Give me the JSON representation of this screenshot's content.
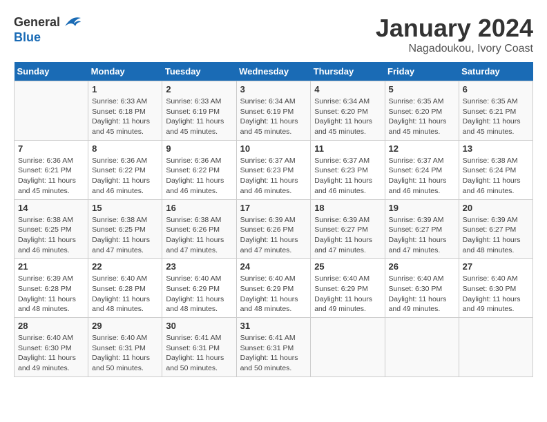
{
  "header": {
    "logo_general": "General",
    "logo_blue": "Blue",
    "month_title": "January 2024",
    "location": "Nagadoukou, Ivory Coast"
  },
  "days_of_week": [
    "Sunday",
    "Monday",
    "Tuesday",
    "Wednesday",
    "Thursday",
    "Friday",
    "Saturday"
  ],
  "weeks": [
    [
      {
        "day": "",
        "info": ""
      },
      {
        "day": "1",
        "info": "Sunrise: 6:33 AM\nSunset: 6:18 PM\nDaylight: 11 hours\nand 45 minutes."
      },
      {
        "day": "2",
        "info": "Sunrise: 6:33 AM\nSunset: 6:19 PM\nDaylight: 11 hours\nand 45 minutes."
      },
      {
        "day": "3",
        "info": "Sunrise: 6:34 AM\nSunset: 6:19 PM\nDaylight: 11 hours\nand 45 minutes."
      },
      {
        "day": "4",
        "info": "Sunrise: 6:34 AM\nSunset: 6:20 PM\nDaylight: 11 hours\nand 45 minutes."
      },
      {
        "day": "5",
        "info": "Sunrise: 6:35 AM\nSunset: 6:20 PM\nDaylight: 11 hours\nand 45 minutes."
      },
      {
        "day": "6",
        "info": "Sunrise: 6:35 AM\nSunset: 6:21 PM\nDaylight: 11 hours\nand 45 minutes."
      }
    ],
    [
      {
        "day": "7",
        "info": "Sunrise: 6:36 AM\nSunset: 6:21 PM\nDaylight: 11 hours\nand 45 minutes."
      },
      {
        "day": "8",
        "info": "Sunrise: 6:36 AM\nSunset: 6:22 PM\nDaylight: 11 hours\nand 46 minutes."
      },
      {
        "day": "9",
        "info": "Sunrise: 6:36 AM\nSunset: 6:22 PM\nDaylight: 11 hours\nand 46 minutes."
      },
      {
        "day": "10",
        "info": "Sunrise: 6:37 AM\nSunset: 6:23 PM\nDaylight: 11 hours\nand 46 minutes."
      },
      {
        "day": "11",
        "info": "Sunrise: 6:37 AM\nSunset: 6:23 PM\nDaylight: 11 hours\nand 46 minutes."
      },
      {
        "day": "12",
        "info": "Sunrise: 6:37 AM\nSunset: 6:24 PM\nDaylight: 11 hours\nand 46 minutes."
      },
      {
        "day": "13",
        "info": "Sunrise: 6:38 AM\nSunset: 6:24 PM\nDaylight: 11 hours\nand 46 minutes."
      }
    ],
    [
      {
        "day": "14",
        "info": "Sunrise: 6:38 AM\nSunset: 6:25 PM\nDaylight: 11 hours\nand 46 minutes."
      },
      {
        "day": "15",
        "info": "Sunrise: 6:38 AM\nSunset: 6:25 PM\nDaylight: 11 hours\nand 47 minutes."
      },
      {
        "day": "16",
        "info": "Sunrise: 6:38 AM\nSunset: 6:26 PM\nDaylight: 11 hours\nand 47 minutes."
      },
      {
        "day": "17",
        "info": "Sunrise: 6:39 AM\nSunset: 6:26 PM\nDaylight: 11 hours\nand 47 minutes."
      },
      {
        "day": "18",
        "info": "Sunrise: 6:39 AM\nSunset: 6:27 PM\nDaylight: 11 hours\nand 47 minutes."
      },
      {
        "day": "19",
        "info": "Sunrise: 6:39 AM\nSunset: 6:27 PM\nDaylight: 11 hours\nand 47 minutes."
      },
      {
        "day": "20",
        "info": "Sunrise: 6:39 AM\nSunset: 6:27 PM\nDaylight: 11 hours\nand 48 minutes."
      }
    ],
    [
      {
        "day": "21",
        "info": "Sunrise: 6:39 AM\nSunset: 6:28 PM\nDaylight: 11 hours\nand 48 minutes."
      },
      {
        "day": "22",
        "info": "Sunrise: 6:40 AM\nSunset: 6:28 PM\nDaylight: 11 hours\nand 48 minutes."
      },
      {
        "day": "23",
        "info": "Sunrise: 6:40 AM\nSunset: 6:29 PM\nDaylight: 11 hours\nand 48 minutes."
      },
      {
        "day": "24",
        "info": "Sunrise: 6:40 AM\nSunset: 6:29 PM\nDaylight: 11 hours\nand 48 minutes."
      },
      {
        "day": "25",
        "info": "Sunrise: 6:40 AM\nSunset: 6:29 PM\nDaylight: 11 hours\nand 49 minutes."
      },
      {
        "day": "26",
        "info": "Sunrise: 6:40 AM\nSunset: 6:30 PM\nDaylight: 11 hours\nand 49 minutes."
      },
      {
        "day": "27",
        "info": "Sunrise: 6:40 AM\nSunset: 6:30 PM\nDaylight: 11 hours\nand 49 minutes."
      }
    ],
    [
      {
        "day": "28",
        "info": "Sunrise: 6:40 AM\nSunset: 6:30 PM\nDaylight: 11 hours\nand 49 minutes."
      },
      {
        "day": "29",
        "info": "Sunrise: 6:40 AM\nSunset: 6:31 PM\nDaylight: 11 hours\nand 50 minutes."
      },
      {
        "day": "30",
        "info": "Sunrise: 6:41 AM\nSunset: 6:31 PM\nDaylight: 11 hours\nand 50 minutes."
      },
      {
        "day": "31",
        "info": "Sunrise: 6:41 AM\nSunset: 6:31 PM\nDaylight: 11 hours\nand 50 minutes."
      },
      {
        "day": "",
        "info": ""
      },
      {
        "day": "",
        "info": ""
      },
      {
        "day": "",
        "info": ""
      }
    ]
  ]
}
